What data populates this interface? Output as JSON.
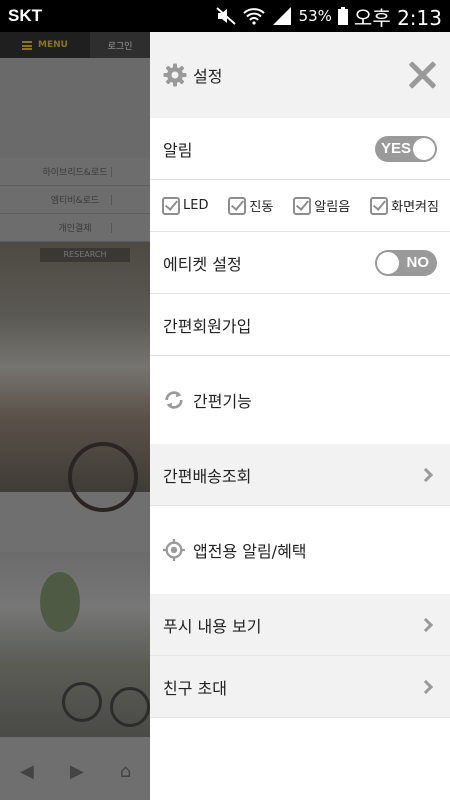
{
  "status_bar": {
    "carrier": "SKT",
    "battery": "53%",
    "time": "오후 2:13"
  },
  "background_page": {
    "menu_label": "MENU",
    "login_label": "로그인",
    "links": [
      "하이브리드&로드",
      "엠티비&로드",
      "개인결제"
    ],
    "sign_text": "RESEARCH"
  },
  "drawer": {
    "header": {
      "title": "설정",
      "settings_icon": "gear-icon",
      "close_icon": "close-icon"
    },
    "notification": {
      "label": "알림",
      "toggle": "YES",
      "enabled": true
    },
    "options": [
      {
        "label": "LED",
        "checked": true
      },
      {
        "label": "진동",
        "checked": true
      },
      {
        "label": "알림음",
        "checked": true
      },
      {
        "label": "화면켜짐",
        "checked": true
      }
    ],
    "etiquette": {
      "label": "에티켓 설정",
      "toggle": "NO",
      "enabled": false
    },
    "easy_signup": {
      "label": "간편회원가입"
    },
    "easy_functions": {
      "label": "간편기능",
      "icon": "refresh-icon"
    },
    "delivery": {
      "label": "간편배송조회"
    },
    "app_benefits": {
      "label": "앱전용 알림/혜택",
      "icon": "target-icon"
    },
    "push_view": {
      "label": "푸시 내용 보기"
    },
    "invite": {
      "label": "친구 초대"
    }
  },
  "colors": {
    "icon_gray": "#9a9a9a",
    "section_bg": "#f2f2f2",
    "statusbar_bg": "#000000"
  }
}
